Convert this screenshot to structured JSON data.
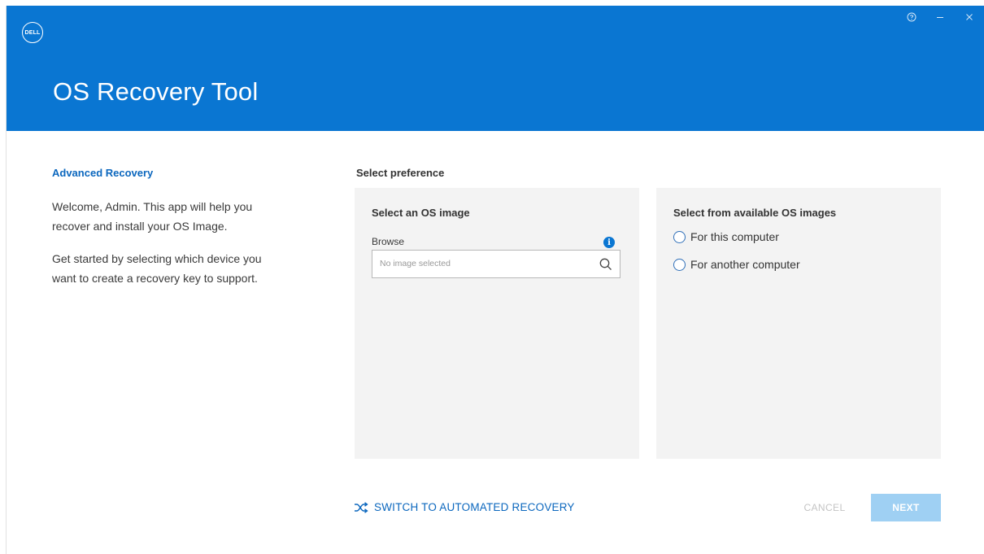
{
  "window": {
    "title": "OS Recovery Tool",
    "brand_logo_text": "DELL",
    "accent_color": "#0a76d2",
    "controls": {
      "help_icon": "help-circle-icon",
      "minimize_icon": "minimize-icon",
      "close_icon": "close-icon"
    }
  },
  "left_panel": {
    "heading": "Advanced Recovery",
    "welcome_text": "Welcome, Admin. This app will help you recover and install your OS Image.",
    "instructions_text": "Get started by selecting which device you want to create a recovery key to support."
  },
  "preferences": {
    "heading": "Select preference",
    "os_image_panel": {
      "title": "Select an OS image",
      "browse_label": "Browse",
      "browse_placeholder": "No image selected",
      "info_icon": "info-icon",
      "search_icon": "search-icon"
    },
    "available_panel": {
      "title": "Select from available OS images",
      "options": [
        {
          "label": "For this computer",
          "selected": false
        },
        {
          "label": "For another computer",
          "selected": false
        }
      ]
    }
  },
  "footer": {
    "switch_label": "SWITCH TO AUTOMATED RECOVERY",
    "switch_icon": "shuffle-icon",
    "cancel_label": "CANCEL",
    "next_label": "NEXT",
    "cancel_enabled": false,
    "next_enabled": false
  }
}
